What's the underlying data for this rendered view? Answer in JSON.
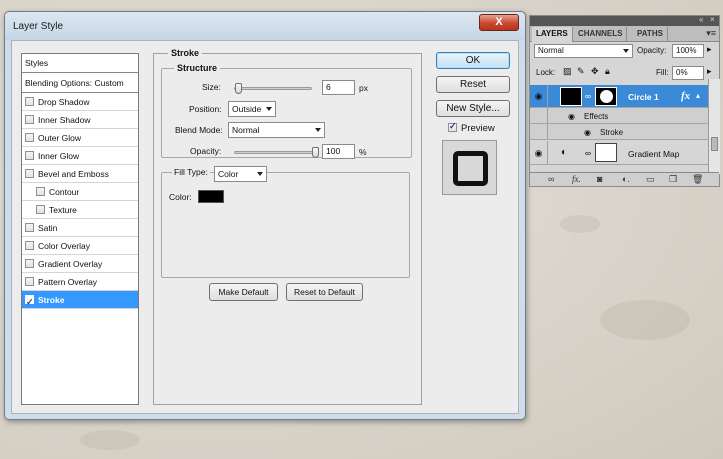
{
  "dialog": {
    "title": "Layer Style",
    "close_label": "X",
    "styles_list": [
      {
        "label": "Styles",
        "checkbox": false,
        "checked": false
      },
      {
        "label": "Blending Options: Custom",
        "checkbox": false,
        "checked": false
      },
      {
        "label": "Drop Shadow",
        "checkbox": true,
        "checked": false
      },
      {
        "label": "Inner Shadow",
        "checkbox": true,
        "checked": false
      },
      {
        "label": "Outer Glow",
        "checkbox": true,
        "checked": false
      },
      {
        "label": "Inner Glow",
        "checkbox": true,
        "checked": false
      },
      {
        "label": "Bevel and Emboss",
        "checkbox": true,
        "checked": false
      },
      {
        "label": "Contour",
        "checkbox": true,
        "checked": false
      },
      {
        "label": "Texture",
        "checkbox": true,
        "checked": false
      },
      {
        "label": "Satin",
        "checkbox": true,
        "checked": false
      },
      {
        "label": "Color Overlay",
        "checkbox": true,
        "checked": false
      },
      {
        "label": "Gradient Overlay",
        "checkbox": true,
        "checked": false
      },
      {
        "label": "Pattern Overlay",
        "checkbox": true,
        "checked": false
      },
      {
        "label": "Stroke",
        "checkbox": true,
        "checked": true
      }
    ],
    "stroke": {
      "group_title": "Stroke",
      "structure_title": "Structure",
      "size_label": "Size:",
      "size_value": "6",
      "size_unit": "px",
      "size_fraction": 0.02,
      "position_label": "Position:",
      "position_value": "Outside",
      "blend_mode_label": "Blend Mode:",
      "blend_mode_value": "Normal",
      "opacity_label": "Opacity:",
      "opacity_value": "100",
      "opacity_unit": "%",
      "opacity_fraction": 1.0,
      "fill_type_label": "Fill Type:",
      "fill_type_value": "Color",
      "color_label": "Color:",
      "color_value": "#000000"
    },
    "make_default_label": "Make Default",
    "reset_default_label": "Reset to Default",
    "ok_label": "OK",
    "reset_label": "Reset",
    "new_style_label": "New Style...",
    "preview_label": "Preview",
    "preview_checked": true
  },
  "layers_panel": {
    "tabs": [
      "LAYERS",
      "CHANNELS",
      "PATHS"
    ],
    "active_tab": "LAYERS",
    "blend_mode": "Normal",
    "opacity_label": "Opacity:",
    "opacity_value": "100%",
    "lock_label": "Lock:",
    "fill_label": "Fill:",
    "fill_value": "0%",
    "layers": [
      {
        "name": "Circle 1",
        "fx": "fx",
        "active": true
      },
      {
        "name": "Effects",
        "sub": true
      },
      {
        "name": "Stroke",
        "sub": true
      },
      {
        "name": "Gradient Map",
        "active": false
      }
    ],
    "bottom_icons": [
      "link-icon",
      "fx-icon",
      "mask-icon",
      "adjustment-icon",
      "folder-icon",
      "new-layer-icon",
      "trash-icon"
    ]
  },
  "colors": {
    "selected_item": "#3399ff",
    "active_layer": "#3a8ad8",
    "close_button": "#c8492f"
  }
}
